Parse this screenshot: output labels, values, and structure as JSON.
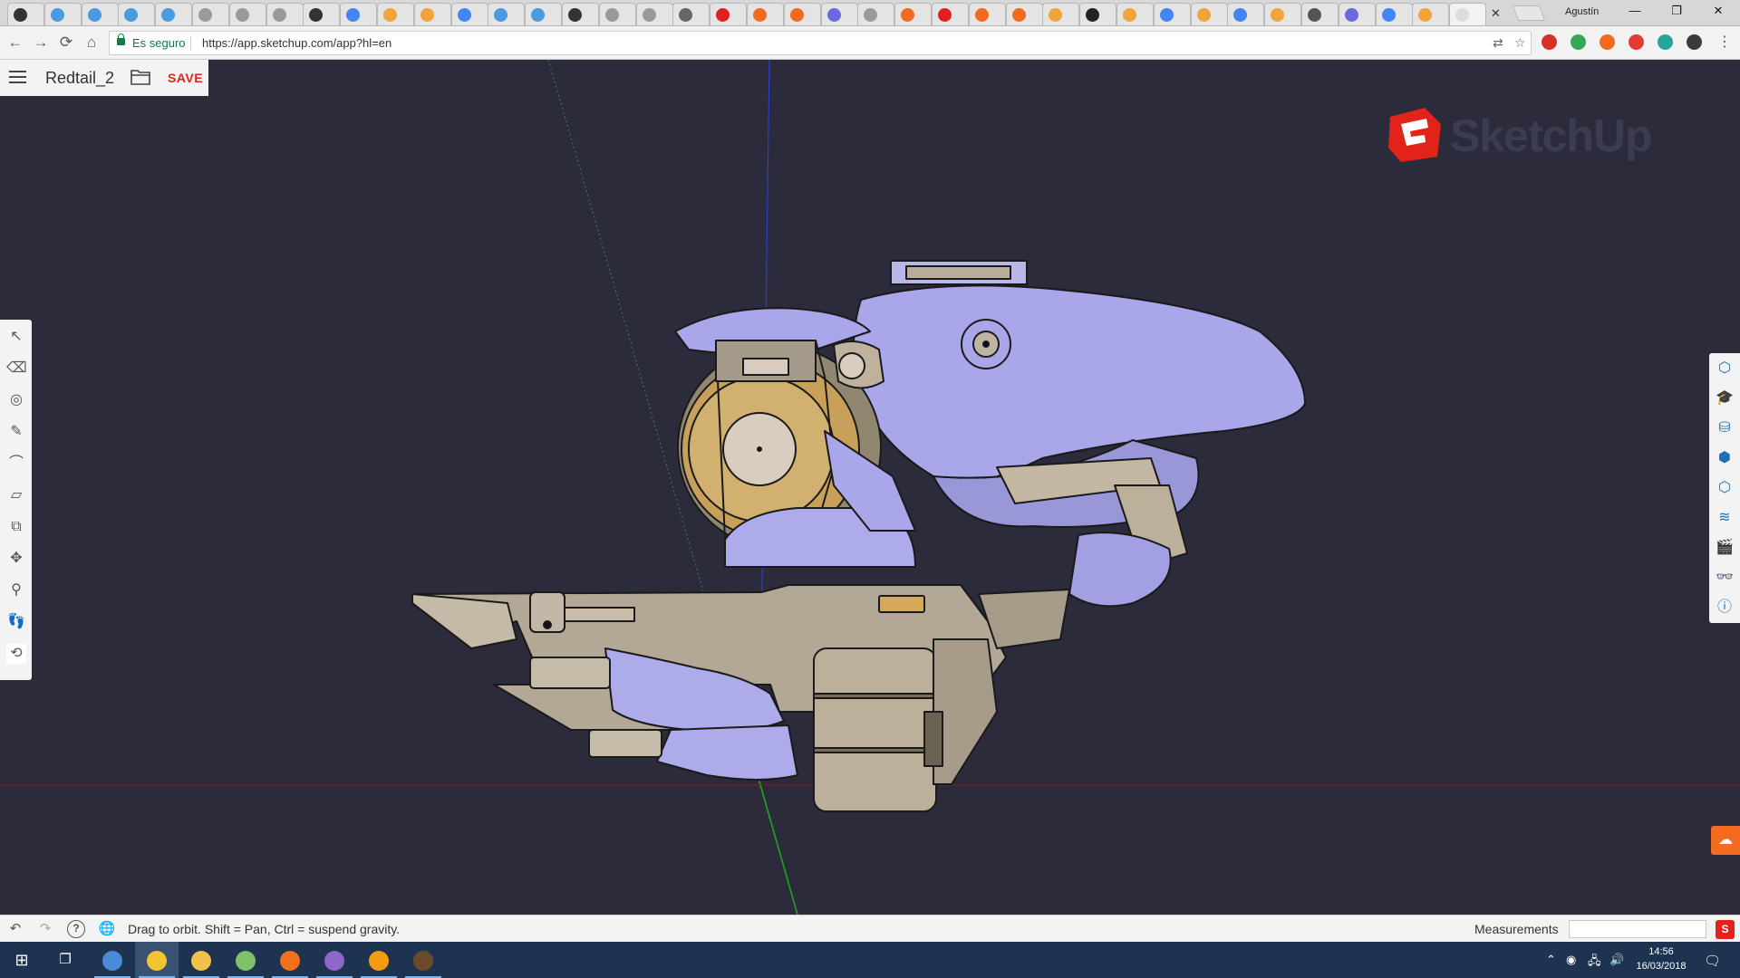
{
  "browser": {
    "tab_count": 40,
    "tab_close": "✕",
    "profile_name": "Agustín",
    "window_controls": {
      "minimize": "—",
      "restore": "❐",
      "close": "✕"
    },
    "nav": {
      "back": "←",
      "forward": "→",
      "reload": "⟳",
      "home": "⌂"
    },
    "secure_label": "Es seguro",
    "url": "https://app.sketchup.com/app?hl=en",
    "menu": "⋮"
  },
  "app": {
    "model_name": "Redtail_2",
    "save_label": "SAVE",
    "logo_text": "SketchUp",
    "brand_color": "#e2231a"
  },
  "left_tools": [
    {
      "name": "select-tool",
      "glyph": "↖"
    },
    {
      "name": "eraser-tool",
      "glyph": "⌫"
    },
    {
      "name": "paint-tool",
      "glyph": "◎"
    },
    {
      "name": "pencil-tool",
      "glyph": "✎"
    },
    {
      "name": "arc-tool",
      "glyph": "⌒"
    },
    {
      "name": "rectangle-tool",
      "glyph": "▱"
    },
    {
      "name": "push-pull-tool",
      "glyph": "⧉"
    },
    {
      "name": "move-tool",
      "glyph": "✥"
    },
    {
      "name": "tape-tool",
      "glyph": "⚲"
    },
    {
      "name": "walk-tool",
      "glyph": "👣"
    },
    {
      "name": "orbit-tool",
      "glyph": "⟲"
    }
  ],
  "right_tools": [
    {
      "name": "entity-info-icon",
      "glyph": "⬡"
    },
    {
      "name": "instructor-icon",
      "glyph": "🎓"
    },
    {
      "name": "components-icon",
      "glyph": "⛁"
    },
    {
      "name": "materials-icon",
      "glyph": "⬢"
    },
    {
      "name": "styles-icon",
      "glyph": "⬡"
    },
    {
      "name": "layers-icon",
      "glyph": "≋"
    },
    {
      "name": "scenes-icon",
      "glyph": "🎬"
    },
    {
      "name": "display-icon",
      "glyph": "👓"
    },
    {
      "name": "model-info-icon",
      "glyph": "ⓘ"
    }
  ],
  "status": {
    "message": "Drag to orbit. Shift = Pan, Ctrl = suspend gravity.",
    "measurements_label": "Measurements",
    "measurements_value": "",
    "undo": "↶",
    "redo": "↷",
    "help": "?",
    "globe": "🌐"
  },
  "taskbar": {
    "start": "⊞",
    "task_view": "❐",
    "time": "14:56",
    "date": "16/03/2018",
    "apps": [
      {
        "name": "edge-app",
        "color": "#4a8ad8"
      },
      {
        "name": "chrome-app",
        "color": "#f3c431"
      },
      {
        "name": "file-explorer-app",
        "color": "#f0c14b"
      },
      {
        "name": "android-studio-app",
        "color": "#7ec16a"
      },
      {
        "name": "firefox-app",
        "color": "#f2711c"
      },
      {
        "name": "github-desktop-app",
        "color": "#8f66c9"
      },
      {
        "name": "sublime-app",
        "color": "#f39c12"
      },
      {
        "name": "game-app",
        "color": "#6b4a2c"
      }
    ]
  }
}
